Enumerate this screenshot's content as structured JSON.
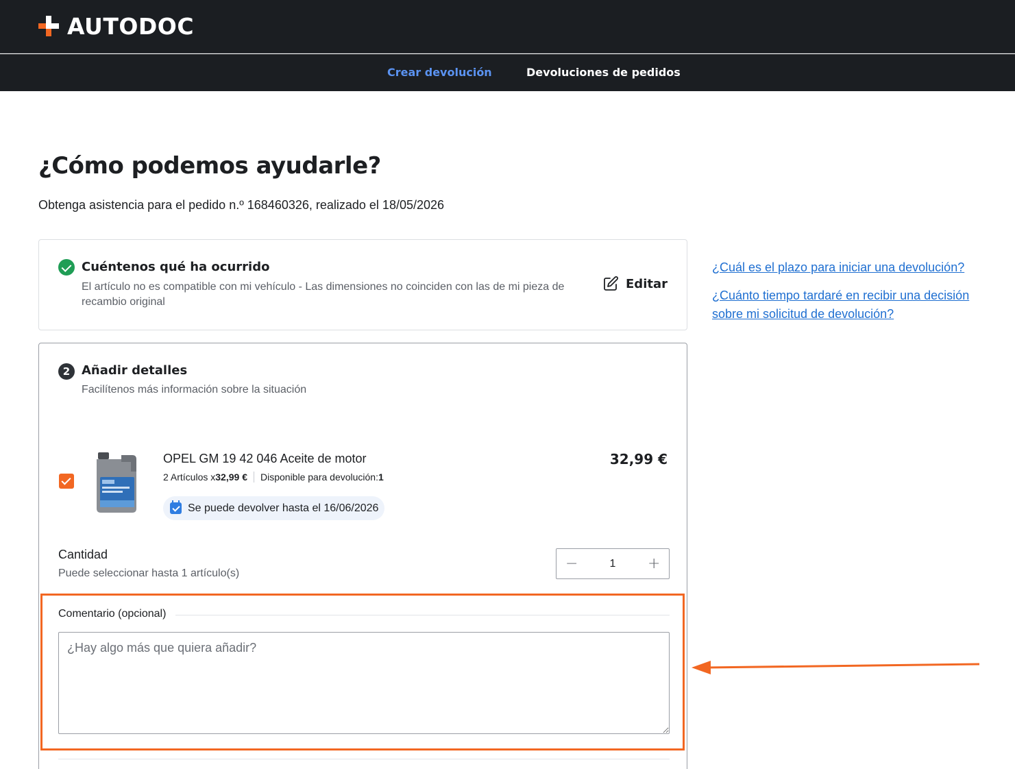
{
  "brand": {
    "name": "AUTODOC",
    "accent": "#f26722"
  },
  "nav": {
    "tabs": [
      {
        "label": "Crear devolución",
        "active": true
      },
      {
        "label": "Devoluciones de pedidos",
        "active": false
      }
    ]
  },
  "page": {
    "title": "¿Cómo podemos ayudarle?",
    "subtitle": "Obtenga asistencia para el pedido n.º 168460326, realizado el 18/05/2026"
  },
  "step1": {
    "title": "Cuéntenos qué ha ocurrido",
    "description": "El artículo no es compatible con mi vehículo - Las dimensiones no coinciden con las de mi pieza de recambio original",
    "edit_label": "Editar",
    "status": "completed"
  },
  "faq": [
    "¿Cuál es el plazo para iniciar una devolución?",
    "¿Cuánto tiempo tardaré en recibir una decisión sobre mi solicitud de devolución?"
  ],
  "step2": {
    "number": "2",
    "title": "Añadir detalles",
    "description": "Facilítenos más información sobre la situación",
    "product": {
      "checked": true,
      "name": "OPEL GM 19 42 046 Aceite de motor",
      "qty_text": "2 Artículos x ",
      "unit_price": "32,99 €",
      "available_label": "Disponible para devolución: ",
      "available_count": "1",
      "price": "32,99 €",
      "return_until": "Se puede devolver hasta el 16/06/2026"
    },
    "quantity": {
      "label": "Cantidad",
      "hint": "Puede seleccionar hasta 1 artículo(s)",
      "value": "1",
      "minus": "−",
      "plus": "+"
    },
    "comment": {
      "label": "Comentario (opcional)",
      "placeholder": "¿Hay algo más que quiera añadir?",
      "value": ""
    }
  }
}
